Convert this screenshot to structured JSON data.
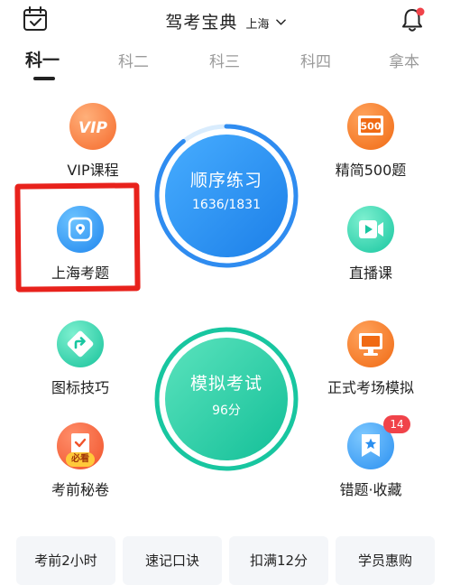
{
  "header": {
    "title": "驾考宝典",
    "city": "上海",
    "icons": {
      "calendar": "calendar-check-icon",
      "bell": "bell-icon",
      "chevron": "chevron-down-icon"
    }
  },
  "tabs": [
    {
      "label": "科一",
      "active": true
    },
    {
      "label": "科二",
      "active": false
    },
    {
      "label": "科三",
      "active": false
    },
    {
      "label": "科四",
      "active": false
    },
    {
      "label": "拿本",
      "active": false
    }
  ],
  "features": {
    "vip": {
      "label": "VIP课程",
      "icon_text": "VIP"
    },
    "jingjian": {
      "label": "精简500题",
      "icon_text": "500"
    },
    "shanghai": {
      "label": "上海考题"
    },
    "zhibo": {
      "label": "直播课"
    },
    "tubiao": {
      "label": "图标技巧"
    },
    "zhengshi": {
      "label": "正式考场模拟"
    },
    "miju": {
      "label": "考前秘卷",
      "badge": "必看"
    },
    "cuoti": {
      "label": "错题·收藏",
      "badge": "14"
    }
  },
  "practice": {
    "title": "顺序练习",
    "progress": "1636/1831",
    "done": 1636,
    "total": 1831
  },
  "exam": {
    "title": "模拟考试",
    "score": "96分"
  },
  "bottom_buttons": [
    {
      "label": "考前2小时"
    },
    {
      "label": "速记口诀"
    },
    {
      "label": "扣满12分"
    },
    {
      "label": "学员惠购"
    }
  ],
  "colors": {
    "blue_ring": "#2f8cf0",
    "green_ring": "#18c6a0",
    "annotation": "#e8221c",
    "badge_red": "#f0434a"
  }
}
